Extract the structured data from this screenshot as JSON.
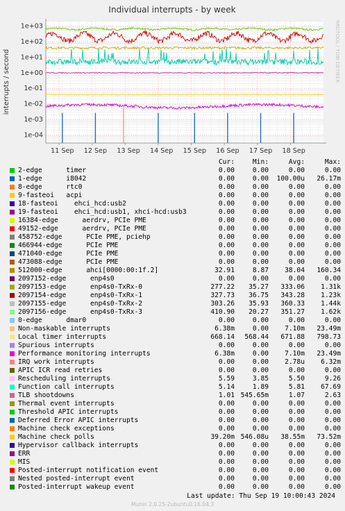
{
  "chart_data": {
    "type": "line",
    "title": "Individual interrupts - by week",
    "ylabel": "interrupts / second",
    "yscale": "log",
    "ylim": [
      3e-05,
      2000
    ],
    "y_ticks": [
      {
        "v": 1000,
        "label": "1e+03"
      },
      {
        "v": 100,
        "label": "1e+02"
      },
      {
        "v": 10,
        "label": "1e+01"
      },
      {
        "v": 1,
        "label": "1e+00"
      },
      {
        "v": 0.1,
        "label": "1e-01"
      },
      {
        "v": 0.01,
        "label": "1e-02"
      },
      {
        "v": 0.001,
        "label": "1e-03"
      },
      {
        "v": 0.0001,
        "label": "1e-04"
      }
    ],
    "x_ticks": [
      "11 Sep",
      "12 Sep",
      "13 Sep",
      "14 Sep",
      "15 Sep",
      "16 Sep",
      "17 Sep",
      "18 Sep"
    ],
    "grid": true,
    "side_label": "RRDTOOL / TOBI OETIKER",
    "series": [
      {
        "key": "local_timer",
        "color": "#66cc00",
        "level": 668
      },
      {
        "key": "ethernet_q",
        "color": "#cc0000",
        "level": 330
      },
      {
        "key": "rescheduling",
        "color": "#ccaa00",
        "level": 40
      },
      {
        "key": "function_call",
        "color": "#00ccaa",
        "level": 5.1
      },
      {
        "key": "ahci",
        "color": "#cc3399",
        "level": 1.0
      },
      {
        "key": "mce_poll",
        "color": "#ffcc00",
        "level": 0.04
      },
      {
        "key": "pmi",
        "color": "#cc00cc",
        "level": 0.007
      },
      {
        "key": "i8042",
        "color": "#1f6fbf",
        "level": 0.0001
      }
    ]
  },
  "legend": {
    "headers": {
      "cur": "Cur:",
      "min": "Min:",
      "avg": "Avg:",
      "max": "Max:"
    },
    "rows": [
      {
        "label": "2-edge      timer",
        "color": "#00cc00",
        "cur": "0.00",
        "min": "0.00",
        "avg": "0.00",
        "max": "0.00"
      },
      {
        "label": "1-edge      i8042",
        "color": "#0066b3",
        "cur": "0.00",
        "min": "0.00",
        "avg": "100.00u",
        "max": "26.17m"
      },
      {
        "label": "8-edge      rtc0",
        "color": "#ff8000",
        "cur": "0.00",
        "min": "0.00",
        "avg": "0.00",
        "max": "0.00"
      },
      {
        "label": "9-fasteoi   acpi",
        "color": "#ffcc00",
        "cur": "0.00",
        "min": "0.00",
        "avg": "0.00",
        "max": "0.00"
      },
      {
        "label": "18-fasteoi    ehci_hcd:usb2",
        "color": "#330099",
        "cur": "0.00",
        "min": "0.00",
        "avg": "0.00",
        "max": "0.00"
      },
      {
        "label": "19-fasteoi    ehci_hcd:usb1, xhci-hcd:usb3",
        "color": "#990099",
        "cur": "0.00",
        "min": "0.00",
        "avg": "0.00",
        "max": "0.00"
      },
      {
        "label": "16384-edge      aerdrv, PCIe PME",
        "color": "#ccff00",
        "cur": "0.00",
        "min": "0.00",
        "avg": "0.00",
        "max": "0.00"
      },
      {
        "label": "49152-edge      aerdrv, PCIe PME",
        "color": "#ff0000",
        "cur": "0.00",
        "min": "0.00",
        "avg": "0.00",
        "max": "0.00"
      },
      {
        "label": "458752-edge      PCIe PME, pciehp",
        "color": "#808080",
        "cur": "0.00",
        "min": "0.00",
        "avg": "0.00",
        "max": "0.00"
      },
      {
        "label": "466944-edge      PCIe PME",
        "color": "#008f00",
        "cur": "0.00",
        "min": "0.00",
        "avg": "0.00",
        "max": "0.00"
      },
      {
        "label": "471040-edge      PCIe PME",
        "color": "#00487d",
        "cur": "0.00",
        "min": "0.00",
        "avg": "0.00",
        "max": "0.00"
      },
      {
        "label": "473088-edge      PCIe PME",
        "color": "#b35a00",
        "cur": "0.00",
        "min": "0.00",
        "avg": "0.00",
        "max": "0.00"
      },
      {
        "label": "512000-edge      ahci[0000:00:1f.2]",
        "color": "#b38f00",
        "cur": "32.91",
        "min": "8.87",
        "avg": "38.04",
        "max": "160.34"
      },
      {
        "label": "2097152-edge      enp4s0",
        "color": "#6b006b",
        "cur": "0.00",
        "min": "0.00",
        "avg": "0.00",
        "max": "0.00"
      },
      {
        "label": "2097153-edge      enp4s0-TxRx-0",
        "color": "#8fb300",
        "cur": "277.22",
        "min": "35.27",
        "avg": "333.06",
        "max": "1.31k"
      },
      {
        "label": "2097154-edge      enp4s0-TxRx-1",
        "color": "#b30000",
        "cur": "327.73",
        "min": "36.75",
        "avg": "343.28",
        "max": "1.23k"
      },
      {
        "label": "2097155-edge      enp4s0-TxRx-2",
        "color": "#bebebe",
        "cur": "303.26",
        "min": "35.93",
        "avg": "360.33",
        "max": "1.44k"
      },
      {
        "label": "2097156-edge      enp4s0-TxRx-3",
        "color": "#80ff80",
        "cur": "410.90",
        "min": "20.27",
        "avg": "351.27",
        "max": "1.62k"
      },
      {
        "label": "0-edge      dmar0",
        "color": "#80c9ff",
        "cur": "0.00",
        "min": "0.00",
        "avg": "0.00",
        "max": "0.00"
      },
      {
        "label": "Non-maskable interrupts",
        "color": "#ffc080",
        "cur": "6.38m",
        "min": "0.00",
        "avg": "7.10m",
        "max": "23.49m"
      },
      {
        "label": "Local timer interrupts",
        "color": "#ffe680",
        "cur": "668.14",
        "min": "568.44",
        "avg": "671.88",
        "max": "798.73"
      },
      {
        "label": "Spurious interrupts",
        "color": "#aa80ff",
        "cur": "0.00",
        "min": "0.00",
        "avg": "0.00",
        "max": "0.00"
      },
      {
        "label": "Performance monitoring interrupts",
        "color": "#ee00cc",
        "cur": "6.38m",
        "min": "0.00",
        "avg": "7.10m",
        "max": "23.49m"
      },
      {
        "label": "IRQ work interrupts",
        "color": "#ff8080",
        "cur": "0.00",
        "min": "0.00",
        "avg": "2.78u",
        "max": "6.32m"
      },
      {
        "label": "APIC ICR read retries",
        "color": "#666600",
        "cur": "0.00",
        "min": "0.00",
        "avg": "0.00",
        "max": "0.00"
      },
      {
        "label": "Rescheduling interrupts",
        "color": "#ffbfff",
        "cur": "5.59",
        "min": "3.85",
        "avg": "5.50",
        "max": "9.26"
      },
      {
        "label": "Function call interrupts",
        "color": "#00ffcc",
        "cur": "5.14",
        "min": "1.89",
        "avg": "5.81",
        "max": "67.69"
      },
      {
        "label": "TLB shootdowns",
        "color": "#cc6699",
        "cur": "1.01",
        "min": "545.65m",
        "avg": "1.07",
        "max": "2.63"
      },
      {
        "label": "Thermal event interrupts",
        "color": "#999900",
        "cur": "0.00",
        "min": "0.00",
        "avg": "0.00",
        "max": "0.00"
      },
      {
        "label": "Threshold APIC interrupts",
        "color": "#00cc00",
        "cur": "0.00",
        "min": "0.00",
        "avg": "0.00",
        "max": "0.00"
      },
      {
        "label": "Deferred Error APIC interrupts",
        "color": "#0066b3",
        "cur": "0.00",
        "min": "0.00",
        "avg": "0.00",
        "max": "0.00"
      },
      {
        "label": "Machine check exceptions",
        "color": "#ff8000",
        "cur": "0.00",
        "min": "0.00",
        "avg": "0.00",
        "max": "0.00"
      },
      {
        "label": "Machine check polls",
        "color": "#ffcc00",
        "cur": "39.20m",
        "min": "546.08u",
        "avg": "38.55m",
        "max": "73.52m"
      },
      {
        "label": "Hypervisor callback interrupts",
        "color": "#330099",
        "cur": "0.00",
        "min": "0.00",
        "avg": "0.00",
        "max": "0.00"
      },
      {
        "label": "ERR",
        "color": "#990099",
        "cur": "0.00",
        "min": "0.00",
        "avg": "0.00",
        "max": "0.00"
      },
      {
        "label": "MIS",
        "color": "#ccff00",
        "cur": "0.00",
        "min": "0.00",
        "avg": "0.00",
        "max": "0.00"
      },
      {
        "label": "Posted-interrupt notification event",
        "color": "#ff0000",
        "cur": "0.00",
        "min": "0.00",
        "avg": "0.00",
        "max": "0.00"
      },
      {
        "label": "Nested posted-interrupt event",
        "color": "#808080",
        "cur": "0.00",
        "min": "0.00",
        "avg": "0.00",
        "max": "0.00"
      },
      {
        "label": "Posted-interrupt wakeup event",
        "color": "#008f00",
        "cur": "0.00",
        "min": "0.00",
        "avg": "0.00",
        "max": "0.00"
      }
    ]
  },
  "footer": {
    "last_update": "Last update:  Thu Sep 19 10:00:43 2024",
    "munin_version": "Munin 2.0.25-2ubuntu0.16.04.3"
  }
}
